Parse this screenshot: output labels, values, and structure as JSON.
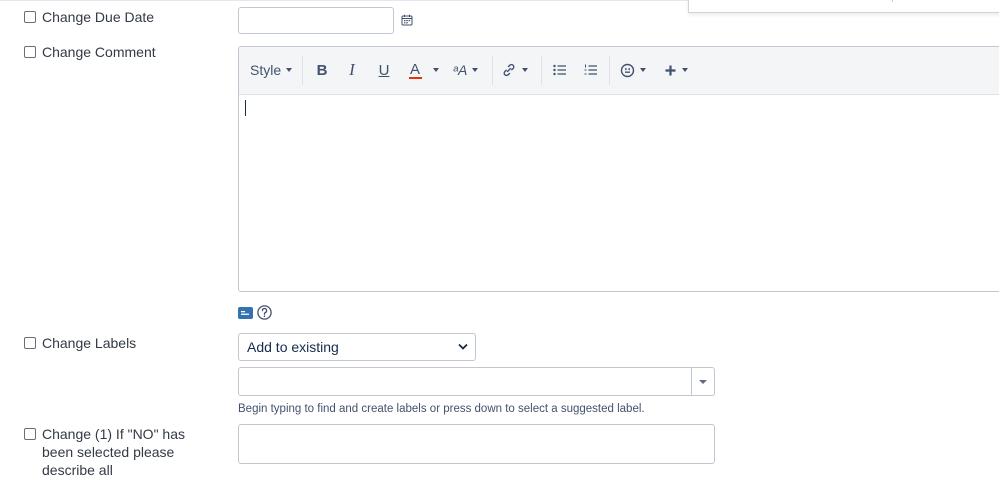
{
  "fields": {
    "due_date": {
      "label": "Change Due Date",
      "value": ""
    },
    "comment": {
      "label": "Change Comment"
    },
    "labels": {
      "label": "Change Labels",
      "mode_selected": "Add to existing",
      "hint": "Begin typing to find and create labels or press down to select a suggested label."
    },
    "custom1": {
      "label": "Change (1) If \"NO\" has been selected please describe all"
    }
  },
  "toolbar": {
    "style_label": "Style",
    "bold": "B",
    "italic": "I",
    "underline": "U",
    "text_color": "A",
    "text_color_bar": "#de350b",
    "more_format": "ᵃA",
    "link_icon": "link-icon",
    "bullet_icon": "bullet-list-icon",
    "numbered_icon": "numbered-list-icon",
    "emoji_icon": "emoji-icon",
    "insert_icon": "plus-icon"
  },
  "icons": {
    "calendar": "calendar-icon",
    "wiki": "wiki-markup-icon",
    "help": "help-icon"
  },
  "colors": {
    "border": "#c1c7d0",
    "toolbar_bg": "#f4f5f7",
    "accent": "#3572b0"
  }
}
